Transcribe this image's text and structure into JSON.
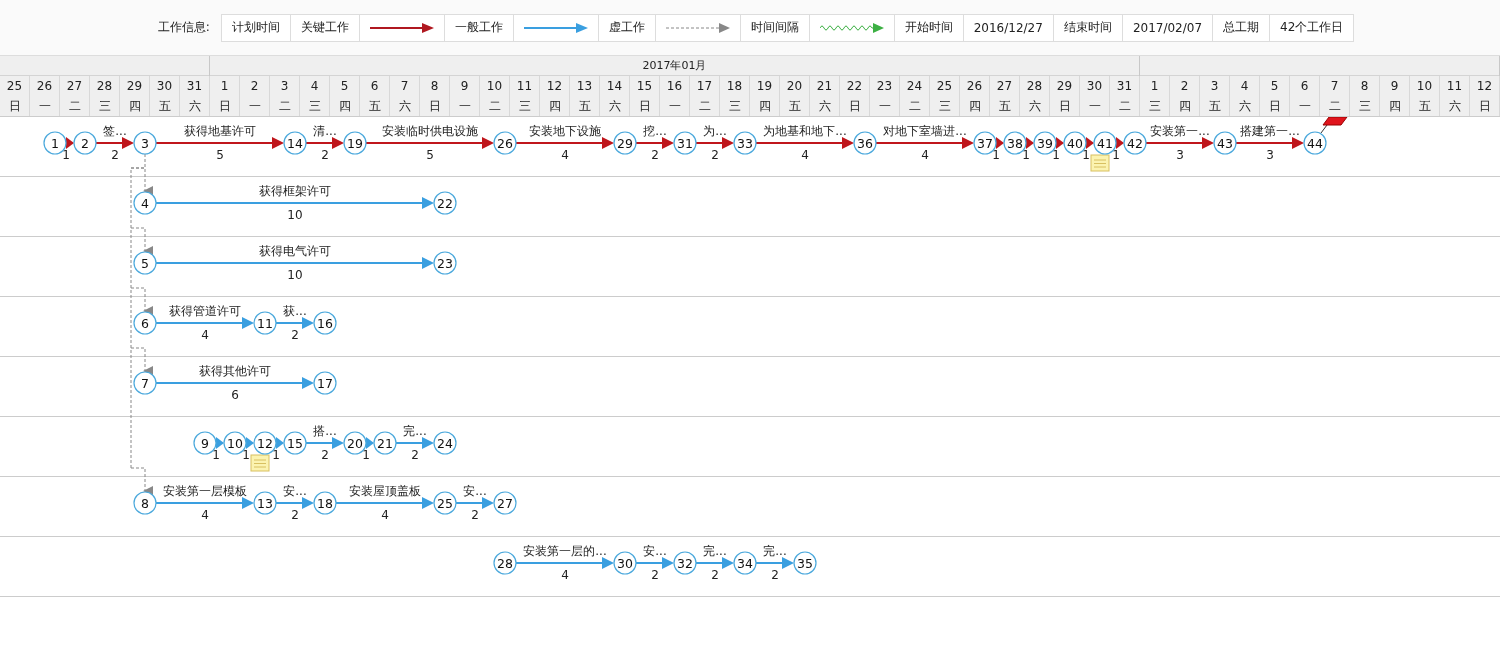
{
  "legend": {
    "title": "工作信息:",
    "items": [
      {
        "kind": "text",
        "label": "计划时间"
      },
      {
        "kind": "text",
        "label": "关键工作"
      },
      {
        "kind": "critical_arrow"
      },
      {
        "kind": "text",
        "label": "一般工作"
      },
      {
        "kind": "normal_arrow"
      },
      {
        "kind": "text",
        "label": "虚工作"
      },
      {
        "kind": "dummy_arrow"
      },
      {
        "kind": "text",
        "label": "时间间隔"
      },
      {
        "kind": "wave_arrow"
      },
      {
        "kind": "text",
        "label": "开始时间"
      },
      {
        "kind": "text",
        "label": "2016/12/27"
      },
      {
        "kind": "text",
        "label": "结束时间"
      },
      {
        "kind": "text",
        "label": "2017/02/07"
      },
      {
        "kind": "text",
        "label": "总工期"
      },
      {
        "kind": "text",
        "label": "42个工作日"
      }
    ]
  },
  "timeline": {
    "months": [
      {
        "days": [
          {
            "day": "25",
            "weekday": "日"
          },
          {
            "day": "26",
            "weekday": "一"
          },
          {
            "day": "27",
            "weekday": "二"
          },
          {
            "day": "28",
            "weekday": "三"
          },
          {
            "day": "29",
            "weekday": "四"
          },
          {
            "day": "30",
            "weekday": "五"
          },
          {
            "day": "31",
            "weekday": "六"
          }
        ]
      },
      {
        "label": "2017年01月",
        "days": [
          {
            "day": "1",
            "weekday": "日"
          },
          {
            "day": "2",
            "weekday": "一"
          },
          {
            "day": "3",
            "weekday": "二"
          },
          {
            "day": "4",
            "weekday": "三"
          },
          {
            "day": "5",
            "weekday": "四"
          },
          {
            "day": "6",
            "weekday": "五"
          },
          {
            "day": "7",
            "weekday": "六"
          },
          {
            "day": "8",
            "weekday": "日"
          },
          {
            "day": "9",
            "weekday": "一"
          },
          {
            "day": "10",
            "weekday": "二"
          },
          {
            "day": "11",
            "weekday": "三"
          },
          {
            "day": "12",
            "weekday": "四"
          },
          {
            "day": "13",
            "weekday": "五"
          },
          {
            "day": "14",
            "weekday": "六"
          },
          {
            "day": "15",
            "weekday": "日"
          },
          {
            "day": "16",
            "weekday": "一"
          },
          {
            "day": "17",
            "weekday": "二"
          },
          {
            "day": "18",
            "weekday": "三"
          },
          {
            "day": "19",
            "weekday": "四"
          },
          {
            "day": "20",
            "weekday": "五"
          },
          {
            "day": "21",
            "weekday": "六"
          },
          {
            "day": "22",
            "weekday": "日"
          },
          {
            "day": "23",
            "weekday": "一"
          },
          {
            "day": "24",
            "weekday": "二"
          },
          {
            "day": "25",
            "weekday": "三"
          },
          {
            "day": "26",
            "weekday": "四"
          },
          {
            "day": "27",
            "weekday": "五"
          },
          {
            "day": "28",
            "weekday": "六"
          },
          {
            "day": "29",
            "weekday": "日"
          },
          {
            "day": "30",
            "weekday": "一"
          },
          {
            "day": "31",
            "weekday": "二"
          }
        ]
      },
      {
        "days": [
          {
            "day": "1",
            "weekday": "三"
          },
          {
            "day": "2",
            "weekday": "四"
          },
          {
            "day": "3",
            "weekday": "五"
          },
          {
            "day": "4",
            "weekday": "六"
          },
          {
            "day": "5",
            "weekday": "日"
          },
          {
            "day": "6",
            "weekday": "一"
          },
          {
            "day": "7",
            "weekday": "二"
          },
          {
            "day": "8",
            "weekday": "三"
          },
          {
            "day": "9",
            "weekday": "四"
          },
          {
            "day": "10",
            "weekday": "五"
          },
          {
            "day": "11",
            "weekday": "六"
          },
          {
            "day": "12",
            "weekday": "日"
          }
        ]
      }
    ]
  },
  "rows": [
    {
      "start": "1",
      "linked": false,
      "end_flag": true,
      "tasks": [
        {
          "to": "2",
          "duration": "1",
          "critical": true
        },
        {
          "to": "3",
          "name": "签...",
          "duration": "2",
          "critical": true
        },
        {
          "to": "14",
          "name": "获得地基许可",
          "duration": "5",
          "critical": true
        },
        {
          "to": "19",
          "name": "清...",
          "duration": "2",
          "critical": true
        },
        {
          "to": "26",
          "name": "安装临时供电设施",
          "duration": "5",
          "critical": true
        },
        {
          "to": "29",
          "name": "安装地下设施",
          "duration": "4",
          "critical": true
        },
        {
          "to": "31",
          "name": "挖...",
          "duration": "2",
          "critical": true
        },
        {
          "to": "33",
          "name": "为...",
          "duration": "2",
          "critical": true
        },
        {
          "to": "36",
          "name": "为地基和地下...",
          "duration": "4",
          "critical": true
        },
        {
          "to": "37",
          "name": "对地下室墙进...",
          "duration": "4",
          "critical": true
        },
        {
          "to": "38",
          "duration": "1",
          "critical": true
        },
        {
          "to": "39",
          "duration": "1",
          "critical": true
        },
        {
          "to": "40",
          "duration": "1",
          "critical": true
        },
        {
          "to": "41",
          "duration": "1",
          "critical": true,
          "note": true
        },
        {
          "to": "42",
          "duration": "1",
          "critical": true
        },
        {
          "to": "43",
          "name": "安装第一...",
          "duration": "3",
          "critical": true
        },
        {
          "to": "44",
          "name": "搭建第一...",
          "duration": "3",
          "critical": true
        }
      ]
    },
    {
      "start": "4",
      "linked": true,
      "tasks": [
        {
          "to": "22",
          "name": "获得框架许可",
          "duration": "10",
          "critical": false
        }
      ]
    },
    {
      "start": "5",
      "linked": true,
      "tasks": [
        {
          "to": "23",
          "name": "获得电气许可",
          "duration": "10",
          "critical": false
        }
      ]
    },
    {
      "start": "6",
      "linked": true,
      "tasks": [
        {
          "to": "11",
          "name": "获得管道许可",
          "duration": "4",
          "critical": false
        },
        {
          "to": "16",
          "name": "获...",
          "duration": "2",
          "critical": false
        }
      ]
    },
    {
      "start": "7",
      "linked": true,
      "tasks": [
        {
          "to": "17",
          "name": "获得其他许可",
          "duration": "6",
          "critical": false
        }
      ]
    },
    {
      "start": "9",
      "linked": false,
      "tasks": [
        {
          "to": "10",
          "duration": "1",
          "critical": false
        },
        {
          "to": "12",
          "duration": "1",
          "critical": false,
          "note": true
        },
        {
          "to": "15",
          "duration": "1",
          "critical": false
        },
        {
          "to": "20",
          "name": "搭...",
          "duration": "2",
          "critical": false
        },
        {
          "to": "21",
          "duration": "1",
          "critical": false
        },
        {
          "to": "24",
          "name": "完...",
          "duration": "2",
          "critical": false
        }
      ]
    },
    {
      "start": "8",
      "linked": true,
      "tasks": [
        {
          "to": "13",
          "name": "安装第一层模板",
          "duration": "4",
          "critical": false
        },
        {
          "to": "18",
          "name": "安...",
          "duration": "2",
          "critical": false
        },
        {
          "to": "25",
          "name": "安装屋顶盖板",
          "duration": "4",
          "critical": false
        },
        {
          "to": "27",
          "name": "安...",
          "duration": "2",
          "critical": false
        }
      ]
    },
    {
      "start": "28",
      "linked": false,
      "tasks": [
        {
          "to": "30",
          "name": "安装第一层的...",
          "duration": "4",
          "critical": false
        },
        {
          "to": "32",
          "name": "安...",
          "duration": "2",
          "critical": false
        },
        {
          "to": "34",
          "name": "完...",
          "duration": "2",
          "critical": false
        },
        {
          "to": "35",
          "name": "完...",
          "duration": "2",
          "critical": false
        }
      ]
    }
  ]
}
